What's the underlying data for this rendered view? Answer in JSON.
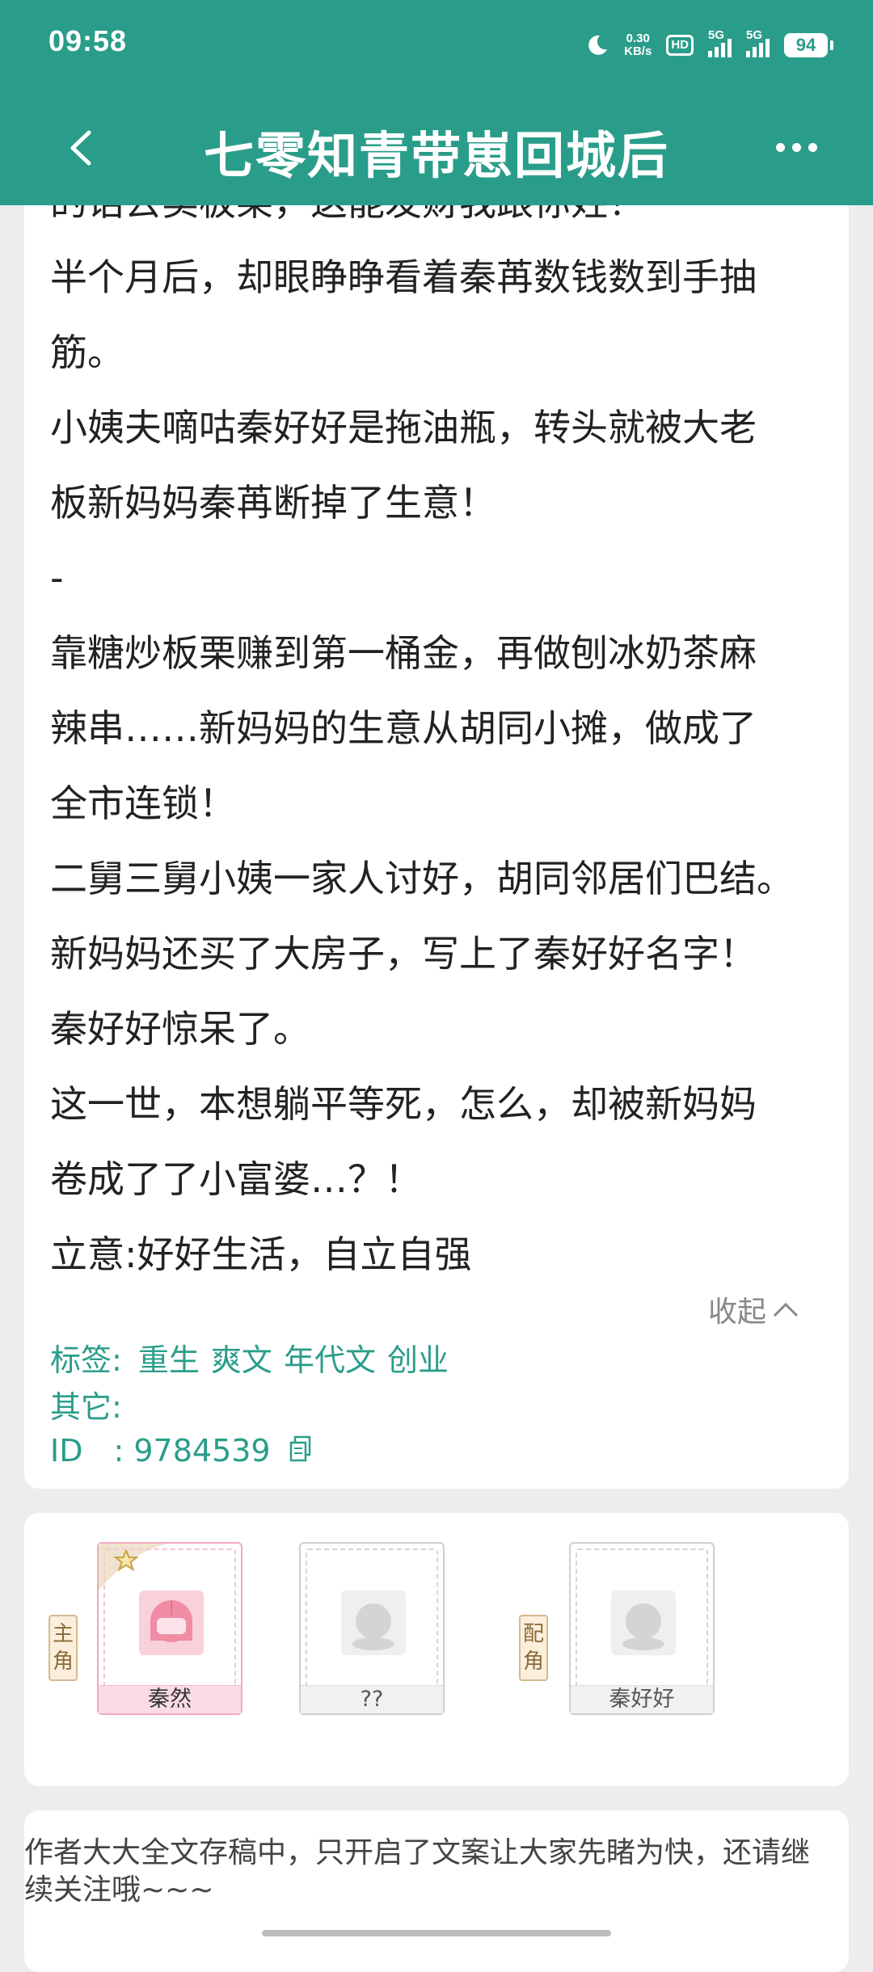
{
  "status": {
    "time": "09:58",
    "net_speed_value": "0.30",
    "net_speed_unit": "KB/s",
    "hd_label": "HD",
    "sim1_label": "5G",
    "sim2_label": "5G",
    "battery": "94"
  },
  "header": {
    "title": "七零知青带崽回城后"
  },
  "synopsis": {
    "lines": [
      "的话去卖板栗，这能发财我跟你姓！",
      "半个月后，却眼睁睁看着秦苒数钱数到手抽",
      "筋。",
      "小姨夫嘀咕秦好好是拖油瓶，转头就被大老",
      "板新妈妈秦苒断掉了生意！",
      "-",
      "靠糖炒板栗赚到第一桶金，再做刨冰奶茶麻",
      "辣串……新妈妈的生意从胡同小摊，做成了",
      "全市连锁！",
      "二舅三舅小姨一家人讨好，胡同邻居们巴结。",
      "新妈妈还买了大房子，写上了秦好好名字！",
      "秦好好惊呆了。",
      "这一世，本想躺平等死，怎么，却被新妈妈",
      "卷成了了小富婆…？！",
      "立意:好好生活，自立自强"
    ],
    "collapse_label": "收起"
  },
  "meta": {
    "tags_label": "标签:",
    "tags": [
      "重生",
      "爽文",
      "年代文",
      "创业"
    ],
    "other_label": "其它:",
    "other_value": "",
    "id_label": "ID　:",
    "id_value": "9784539"
  },
  "characters": {
    "main_tag": [
      "主",
      "角"
    ],
    "support_tag": [
      "配",
      "角"
    ],
    "items": [
      {
        "name": "秦然"
      },
      {
        "name": "??"
      },
      {
        "name": "秦好好"
      }
    ]
  },
  "note": {
    "text": "作者大大全文存稿中，只开启了文案让大家先睹为快，还请继续关注哦~~~"
  }
}
